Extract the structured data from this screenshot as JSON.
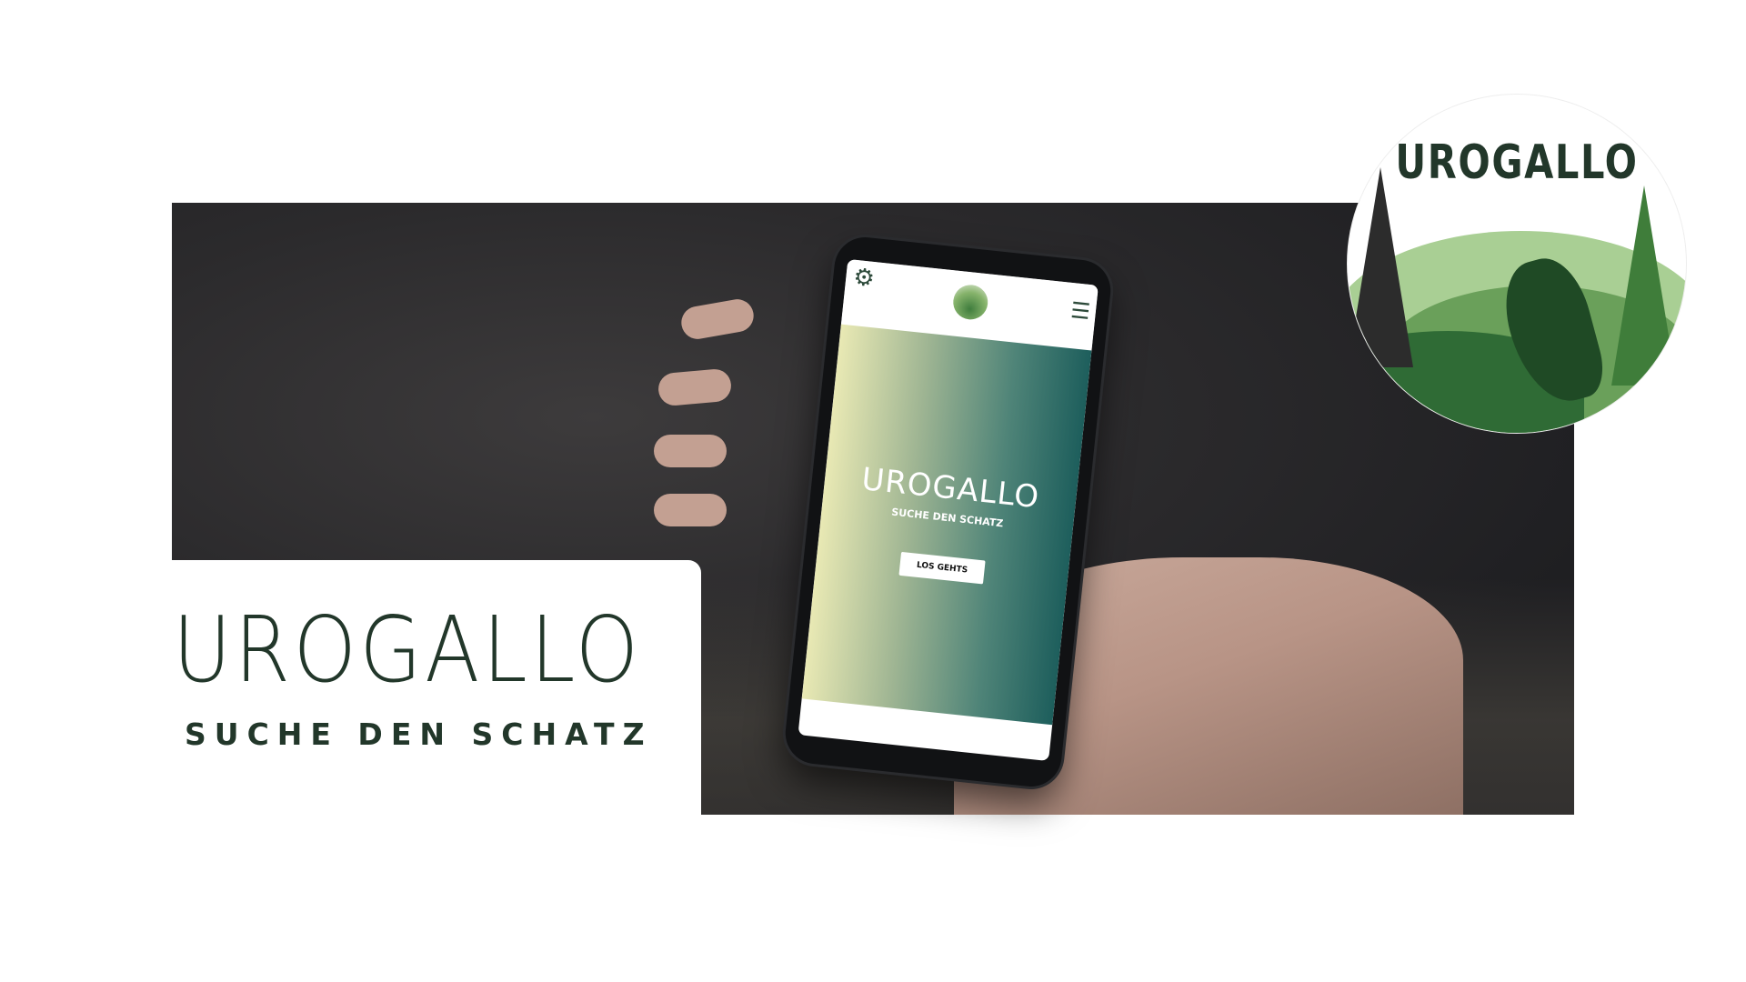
{
  "brand": {
    "title": "UROGALLO",
    "tagline": "SUCHE DEN SCHATZ",
    "primary_color": "#22372a"
  },
  "logo_badge": {
    "text": "UROGALLO"
  },
  "phone_screen": {
    "settings_icon": "gear-icon",
    "menu_icon": "hamburger-menu-icon",
    "hero_title": "UROGALLO",
    "hero_subtitle": "SUCHE DEN SCHATZ",
    "cta_label": "LOS GEHTS",
    "gradient_colors": [
      "#e9e9b4",
      "#1d5e5c"
    ]
  }
}
